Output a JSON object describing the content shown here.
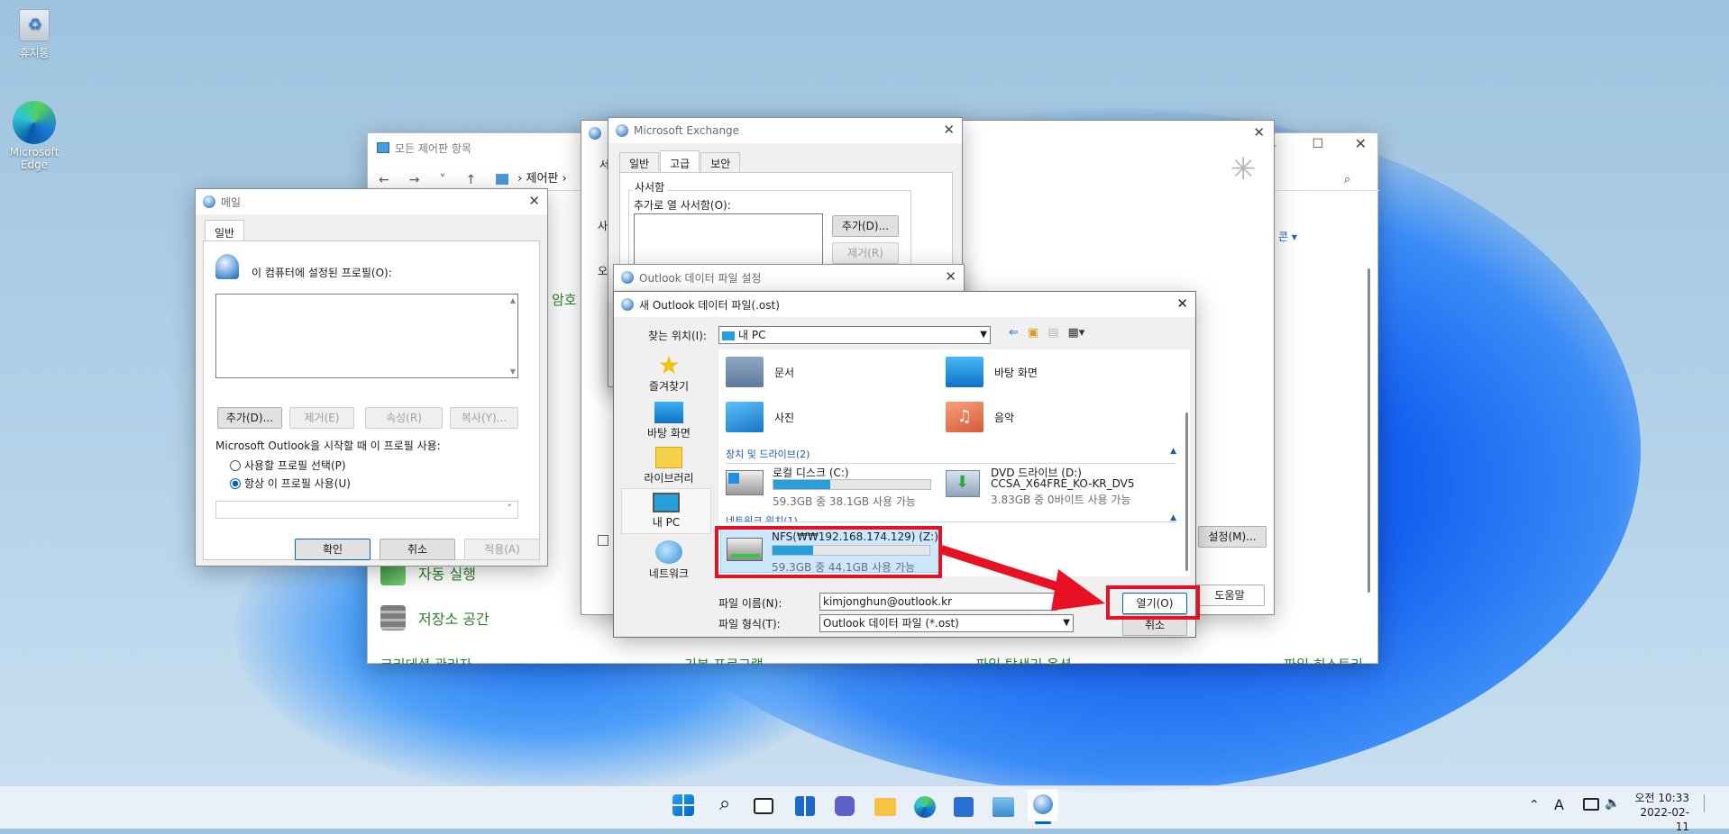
{
  "desktop": {
    "recycle_label": "휴지통",
    "edge_label": "Microsoft Edge"
  },
  "control_panel": {
    "title": "모든 제어판 항목",
    "breadcrumb": "제어판",
    "item_autoplay": "자동 실행",
    "item_storage": "저장소 공간",
    "item_mail_partial": "암호",
    "view_partial": "콘",
    "cut_items": [
      "크리데셜 관리자",
      "기본 프로그램",
      "파일 탐색기 옵션",
      "파일 히스토리"
    ]
  },
  "mail_dialog": {
    "title": "메일",
    "tab": "일반",
    "profiles_label": "이 컴퓨터에 설정된 프로필(O):",
    "buttons": [
      "추가(D)...",
      "제거(E)",
      "속성(R)",
      "복사(Y)..."
    ],
    "startup_label": "Microsoft Outlook을 시작할 때 이 프로필 사용:",
    "radio_prompt": "사용할 프로필 선택(P)",
    "radio_always": "항상 이 프로필 사용(U)",
    "ok": "확인",
    "cancel": "취소",
    "apply": "적용(A)"
  },
  "account_settings": {
    "tab_partial": "서",
    "label1": "사",
    "label2": "오"
  },
  "exchange_dialog": {
    "title": "Microsoft Exchange",
    "tabs": [
      "일반",
      "고급",
      "보안"
    ],
    "group": "사서함",
    "open_label": "추가로 열 사서함(O):",
    "add": "추가(D)...",
    "remove": "제거(R)",
    "settings": "설정(M)...",
    "help": "도움말"
  },
  "datafile_dialog": {
    "title": "Outlook 데이터 파일 설정"
  },
  "open_dialog": {
    "title": "새 Outlook 데이터 파일(.ost)",
    "look_in_label": "찾는 위치(I):",
    "look_in_value": "내 PC",
    "nav": [
      "즐겨찾기",
      "바탕 화면",
      "라이브러리",
      "내 PC",
      "네트워크"
    ],
    "folders": [
      "문서",
      "바탕 화면",
      "사진",
      "음악"
    ],
    "group_devices": "장치 및 드라이브(2)",
    "group_network": "네트워크 위치(1)",
    "drive_c": {
      "name": "로컬 디스크 (C:)",
      "info": "59.3GB 중 38.1GB 사용 가능",
      "used": 0.36
    },
    "drive_d": {
      "name": "DVD 드라이브 (D:)",
      "label": "CCSA_X64FRE_KO-KR_DV5",
      "info": "3.83GB 중 0바이트 사용 가능"
    },
    "drive_z": {
      "name": "NFS(₩₩192.168.174.129) (Z:)",
      "info": "59.3GB 중 44.1GB 사용 가능",
      "used": 0.26
    },
    "filename_label": "파일 이름(N):",
    "filename_value": "kimjonghun@outlook.kr",
    "filetype_label": "파일 형식(T):",
    "filetype_value": "Outlook 데이터 파일 (*.ost)",
    "open_btn": "열기(O)",
    "cancel_btn": "취소"
  },
  "tray": {
    "ampm": "오전",
    "time": "10:33",
    "date": "2022-02-11",
    "ime": "A"
  },
  "colors": {
    "highlight": "#e81123",
    "accent": "#0067c0",
    "usage": "#26a0da"
  }
}
